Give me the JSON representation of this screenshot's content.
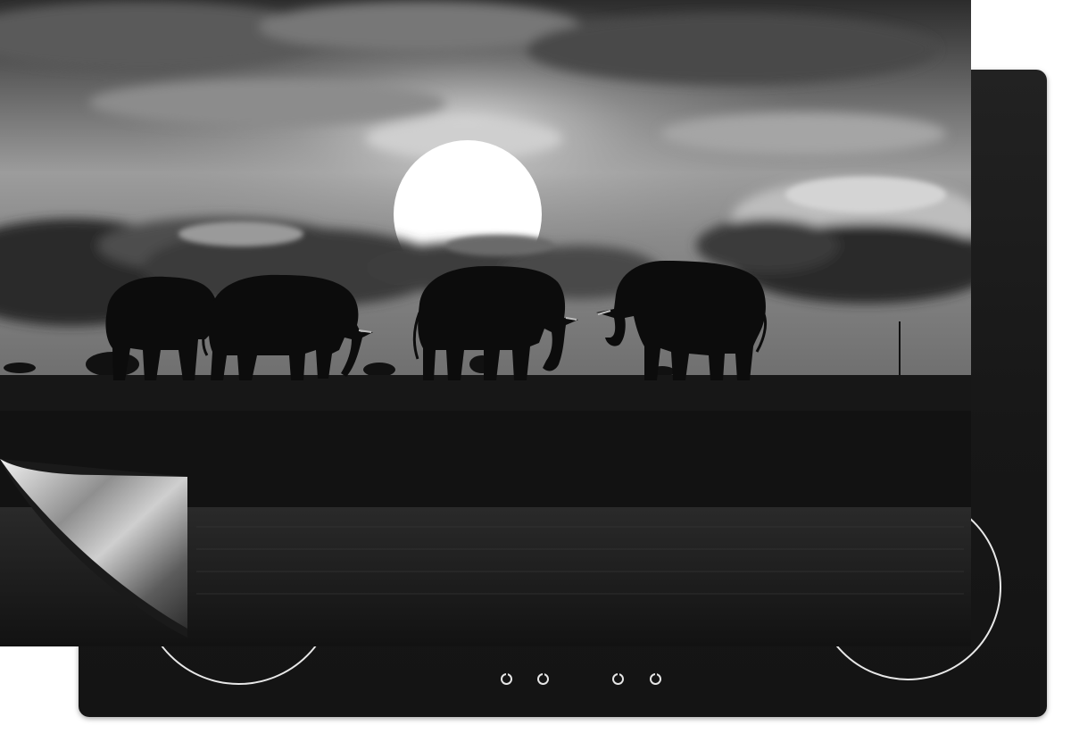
{
  "scene": {
    "subject": "elephants",
    "elephant_count": 4,
    "palette": "black-and-white"
  },
  "product": {
    "type": "induction-hob-protector-mat",
    "controls_count": 4,
    "cooking_zones_visible": 2
  },
  "colors": {
    "hob": "#1a1a1a",
    "zone_ring": "#e8e8e8",
    "sun": "#ffffff",
    "sky_dark": "#2a2a2a",
    "sky_light": "#9a9a9a",
    "water": "#1e1e1e"
  }
}
